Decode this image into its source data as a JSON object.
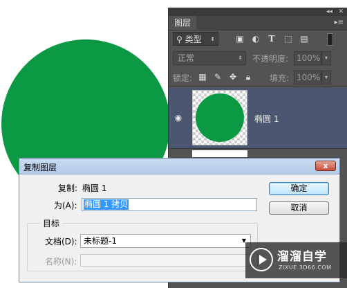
{
  "layers_panel": {
    "tab_label": "图层",
    "filter_label": "类型",
    "blend_mode": "正常",
    "opacity_label": "不透明度:",
    "opacity_value": "100%",
    "lock_label": "锁定:",
    "fill_label": "填充:",
    "fill_value": "100%",
    "layer_name": "椭圆 1"
  },
  "dialog": {
    "title": "复制图层",
    "close_glyph": "x",
    "duplicate_label": "复制:",
    "duplicate_value": "椭圆 1",
    "as_label": "为(A):",
    "as_value": "椭圆 1 拷贝",
    "group_title": "目标",
    "document_label": "文档(D):",
    "document_value": "未标题-1",
    "name_label": "名称(N):",
    "ok_label": "确定",
    "cancel_label": "取消"
  },
  "watermark": {
    "title": "溜溜自学",
    "url": "ZIXUE.3D66.COM"
  },
  "colors": {
    "shape_fill": "#0b9a43",
    "panel_bg": "#535353",
    "selected_layer": "#4b5670"
  },
  "icons": [
    "search-icon",
    "image-filter-icon",
    "adjustment-filter-icon",
    "type-filter-icon",
    "shape-filter-icon",
    "smart-object-filter-icon",
    "lock-transparent-icon",
    "lock-brush-icon",
    "lock-move-icon",
    "lock-all-icon",
    "eye-icon",
    "panel-menu-icon",
    "collapse-icon",
    "close-icon"
  ]
}
